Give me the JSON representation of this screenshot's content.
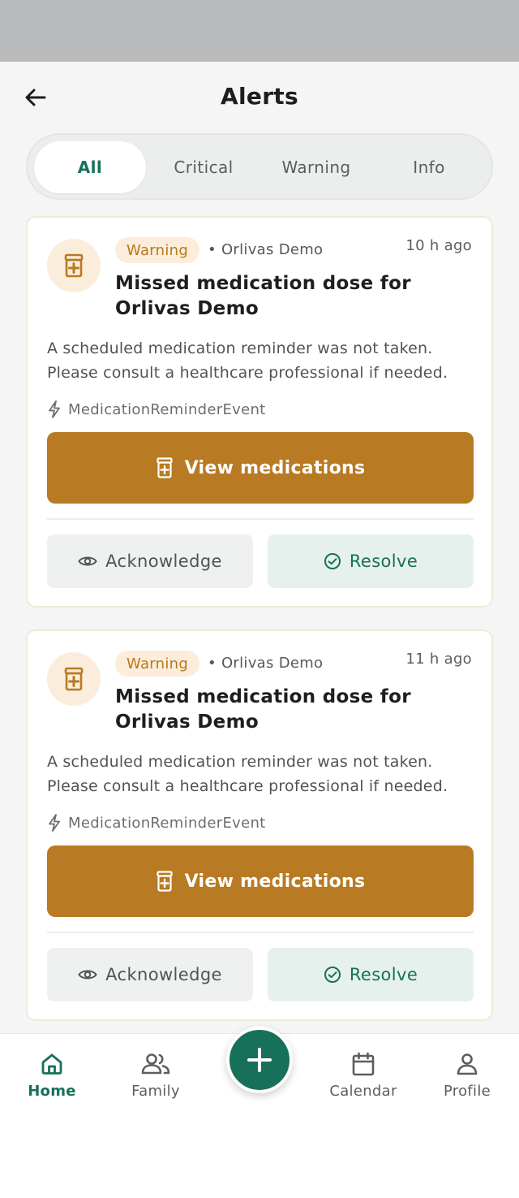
{
  "header": {
    "title": "Alerts"
  },
  "tabs": [
    {
      "label": "All",
      "active": true
    },
    {
      "label": "Critical",
      "active": false
    },
    {
      "label": "Warning",
      "active": false
    },
    {
      "label": "Info",
      "active": false
    }
  ],
  "alerts": [
    {
      "severity": "Warning",
      "subject": "• Orlivas Demo",
      "time": "10 h ago",
      "title": "Missed medication dose for Orlivas Demo",
      "description": "A scheduled medication reminder was not taken. Please consult a healthcare professional if needed.",
      "event": "MedicationReminderEvent",
      "primary_action": "View medications",
      "acknowledge": "Acknowledge",
      "resolve": "Resolve"
    },
    {
      "severity": "Warning",
      "subject": "• Orlivas Demo",
      "time": "11 h ago",
      "title": "Missed medication dose for Orlivas Demo",
      "description": "A scheduled medication reminder was not taken. Please consult a healthcare professional if needed.",
      "event": "MedicationReminderEvent",
      "primary_action": "View medications",
      "acknowledge": "Acknowledge",
      "resolve": "Resolve"
    }
  ],
  "nav": [
    {
      "label": "Home",
      "icon": "home-icon",
      "active": true
    },
    {
      "label": "Family",
      "icon": "family-icon",
      "active": false
    },
    {
      "label": "Calendar",
      "icon": "calendar-icon",
      "active": false
    },
    {
      "label": "Profile",
      "icon": "profile-icon",
      "active": false
    }
  ],
  "fab": {
    "icon": "plus-icon"
  },
  "colors": {
    "accent": "#17705a",
    "warning": "#b87a22",
    "warning_bg": "#fbedda",
    "background": "#f4f5f4"
  }
}
